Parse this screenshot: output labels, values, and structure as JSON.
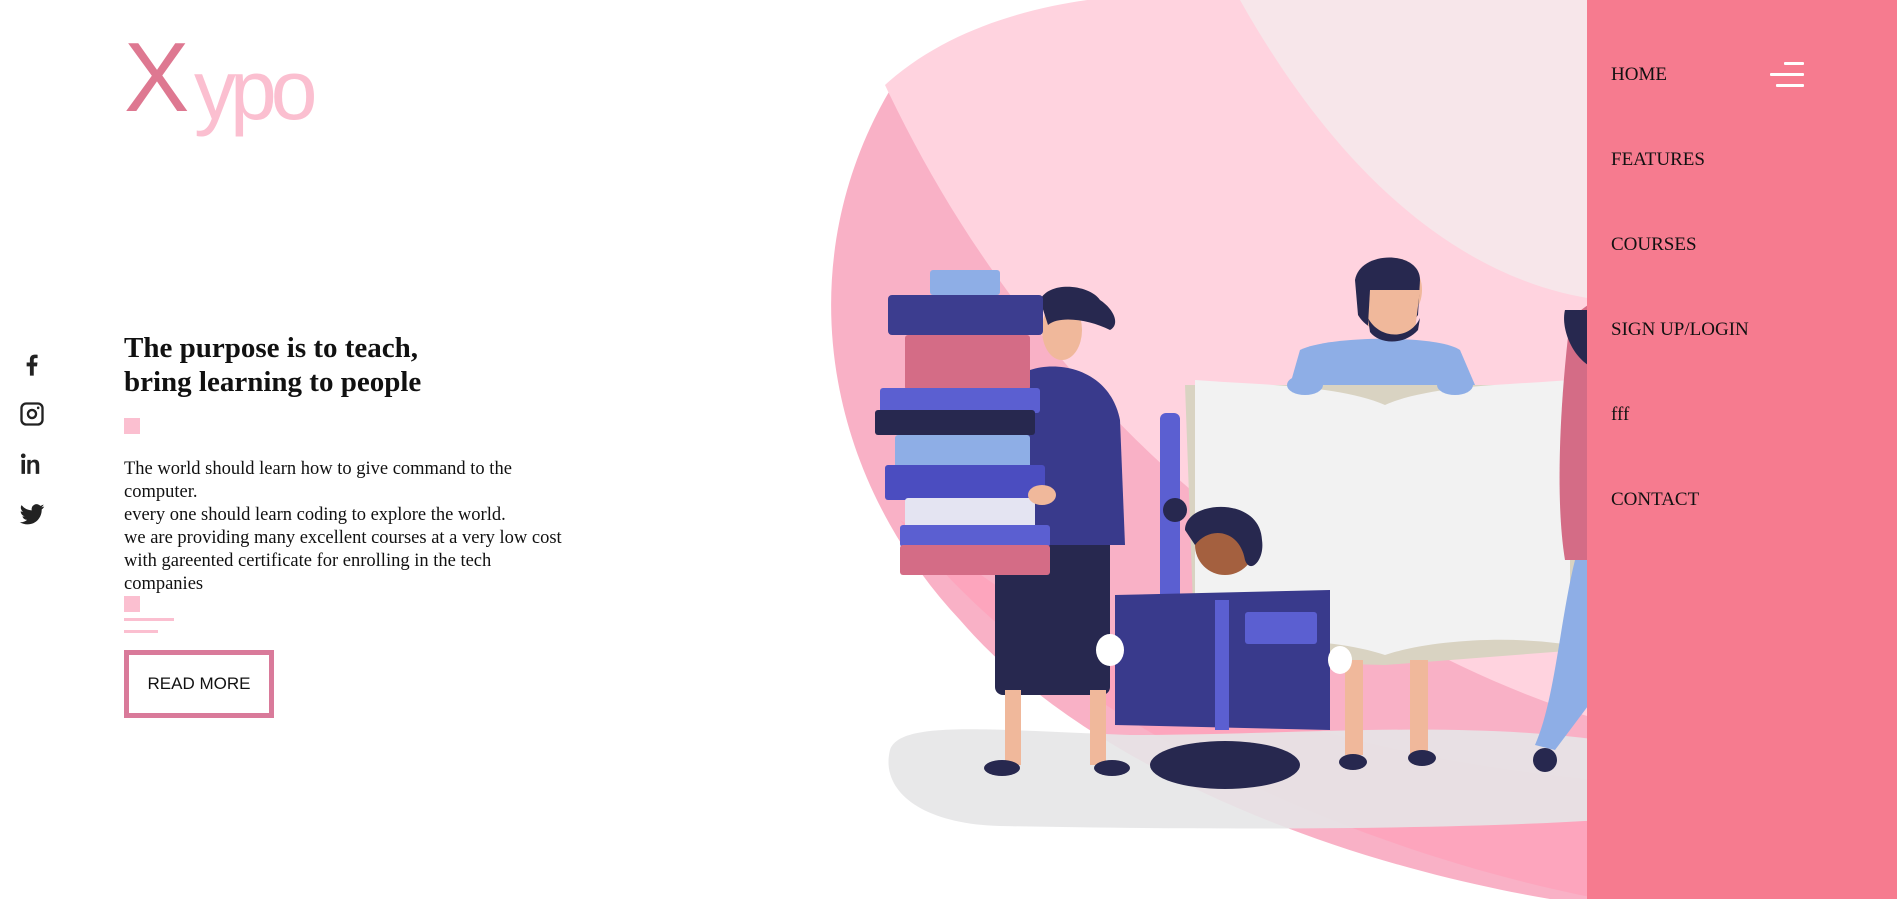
{
  "brand": {
    "logo_x": "X",
    "logo_rest": "ypo"
  },
  "social": [
    {
      "icon": "facebook-icon"
    },
    {
      "icon": "instagram-icon"
    },
    {
      "icon": "linkedin-icon"
    },
    {
      "icon": "twitter-icon"
    }
  ],
  "hero": {
    "title_line1": "The purpose is to teach,",
    "title_line2": "bring learning to people",
    "body_line1": "The world should learn how to give command to the computer.",
    "body_line2": "every one should learn coding to explore the world.",
    "body_line3": "we are providing many excellent courses at a very low cost with gareented certificate for enrolling in the tech companies",
    "cta_label": "READ MORE"
  },
  "nav": {
    "items": [
      {
        "label": "HOME"
      },
      {
        "label": "FEATURES"
      },
      {
        "label": "COURSES"
      },
      {
        "label": "SIGN UP/LOGIN"
      },
      {
        "label": "fff"
      },
      {
        "label": "CONTACT"
      }
    ],
    "toggle_icon": "menu-icon"
  },
  "colors": {
    "sidebar": "#f67b8f",
    "accent_pink": "#fbbfd0",
    "logo_x": "#de7891",
    "button_border": "#d97a9a",
    "illustration_navy": "#2d2d6b",
    "illustration_blue": "#5b5fd1"
  }
}
